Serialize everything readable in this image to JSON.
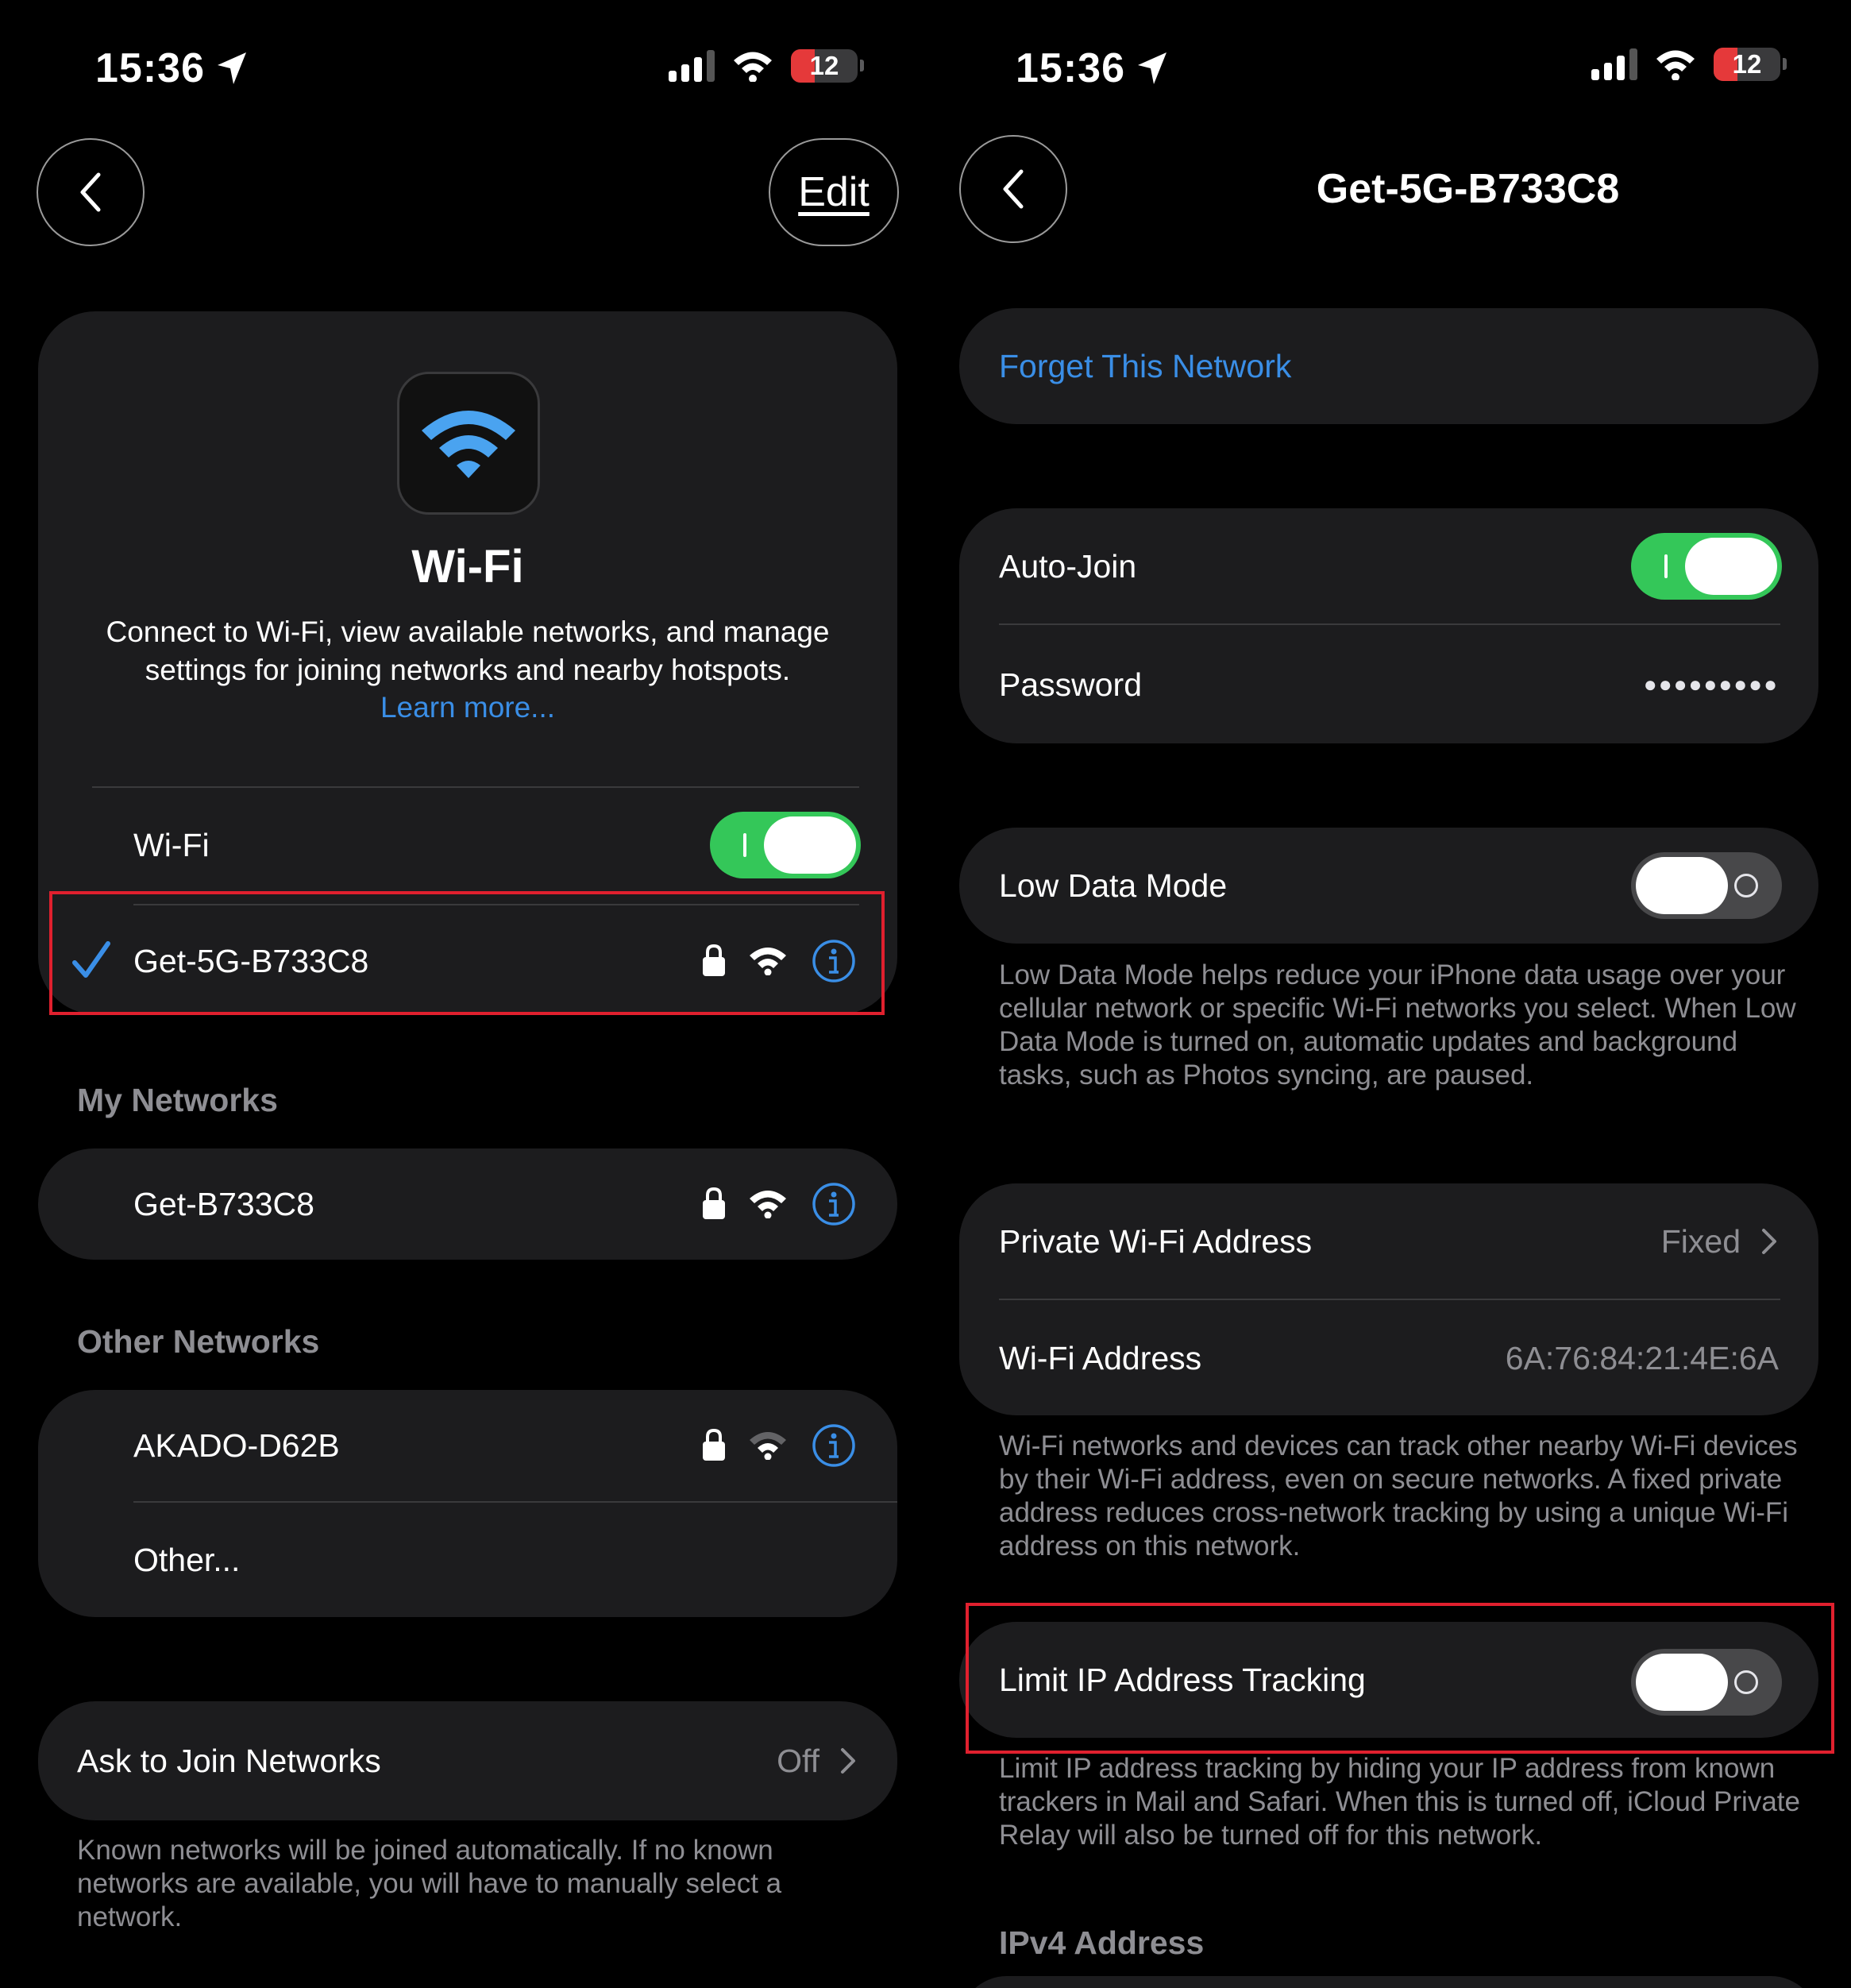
{
  "status_bar": {
    "time": "15:36",
    "battery": "12"
  },
  "left_screen": {
    "edit_label": "Edit",
    "header": {
      "title": "Wi-Fi",
      "description": "Connect to Wi-Fi, view available networks, and manage settings for joining networks and nearby hotspots.",
      "learn_more": "Learn more..."
    },
    "wifi_toggle": {
      "label": "Wi-Fi",
      "on": true
    },
    "connected_network": {
      "name": "Get-5G-B733C8"
    },
    "my_networks": {
      "title": "My Networks",
      "items": [
        {
          "name": "Get-B733C8"
        }
      ]
    },
    "other_networks": {
      "title": "Other Networks",
      "items": [
        {
          "name": "AKADO-D62B"
        }
      ],
      "other_label": "Other..."
    },
    "ask_to_join": {
      "label": "Ask to Join Networks",
      "value": "Off",
      "footnote": "Known networks will be joined automatically. If no known networks are available, you will have to manually select a network."
    }
  },
  "right_screen": {
    "title": "Get-5G-B733C8",
    "forget_label": "Forget This Network",
    "auto_join": {
      "label": "Auto-Join",
      "on": true
    },
    "password": {
      "label": "Password",
      "value": "●●●●●●●●●"
    },
    "low_data_mode": {
      "label": "Low Data Mode",
      "on": false,
      "footnote": "Low Data Mode helps reduce your iPhone data usage over your cellular network or specific Wi-Fi networks you select. When Low Data Mode is turned on, automatic updates and background tasks, such as Photos syncing, are paused."
    },
    "private_address": {
      "label": "Private Wi-Fi Address",
      "value": "Fixed"
    },
    "wifi_address": {
      "label": "Wi-Fi Address",
      "value": "6A:76:84:21:4E:6A",
      "footnote": "Wi-Fi networks and devices can track other nearby Wi-Fi devices by their Wi-Fi address, even on secure networks. A fixed private address reduces cross-network tracking by using a unique Wi-Fi address on this network."
    },
    "limit_ip": {
      "label": "Limit IP Address Tracking",
      "on": false,
      "footnote": "Limit IP address tracking by hiding your IP address from known trackers in Mail and Safari. When this is turned off, iCloud Private Relay will also be turned off for this network."
    },
    "ipv4_title": "IPv4 Address"
  },
  "colors": {
    "background": "#000000",
    "card": "#1c1c1e",
    "accent_blue": "#3a8ee6",
    "toggle_on": "#34c759",
    "toggle_off": "#48484a",
    "secondary_text": "#8e8e93",
    "battery_red": "#e5393a",
    "highlight_red": "#e0202e"
  }
}
